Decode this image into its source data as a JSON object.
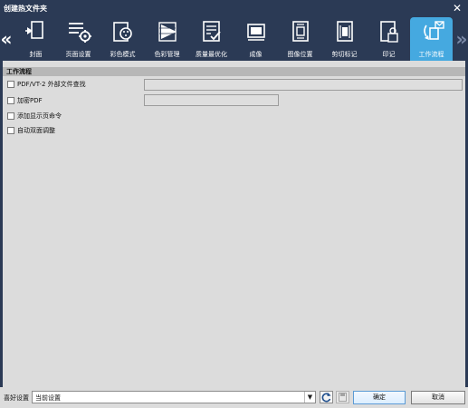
{
  "window": {
    "title": "创建热文件夹",
    "close_symbol": "✕"
  },
  "toolbar": {
    "prev_symbol": "«",
    "next_symbol": "»",
    "tabs": [
      {
        "label": "封面",
        "icon": "cover-icon"
      },
      {
        "label": "页面设置",
        "icon": "page-setup-icon"
      },
      {
        "label": "彩色模式",
        "icon": "color-mode-icon"
      },
      {
        "label": "色彩管理",
        "icon": "color-management-icon"
      },
      {
        "label": "质量最优化",
        "icon": "quality-optimization-icon"
      },
      {
        "label": "成像",
        "icon": "imaging-icon"
      },
      {
        "label": "图像位置",
        "icon": "image-position-icon"
      },
      {
        "label": "剪切标记",
        "icon": "crop-marks-icon"
      },
      {
        "label": "印记",
        "icon": "imprint-icon"
      },
      {
        "label": "工作流程",
        "icon": "workflow-icon",
        "active": true
      }
    ]
  },
  "section": {
    "header": "工作流程",
    "items": [
      {
        "label": "PDF/VT-2 外部文件查找",
        "checked": false,
        "field_value": ""
      },
      {
        "label": "加密PDF",
        "checked": false,
        "field_value": ""
      },
      {
        "label": "添加显示页命令",
        "checked": false
      },
      {
        "label": "自动双面调整",
        "checked": false
      }
    ]
  },
  "bottom": {
    "pref_label": "喜好设置",
    "pref_value": "当前设置",
    "dropdown_symbol": "▼",
    "ok_label": "确定",
    "cancel_label": "取消"
  },
  "colors": {
    "chrome_bg": "#2b3a55",
    "active_tab": "#45a9e0",
    "content_bg": "#dcdcdc",
    "section_header": "#b7b7b7"
  }
}
